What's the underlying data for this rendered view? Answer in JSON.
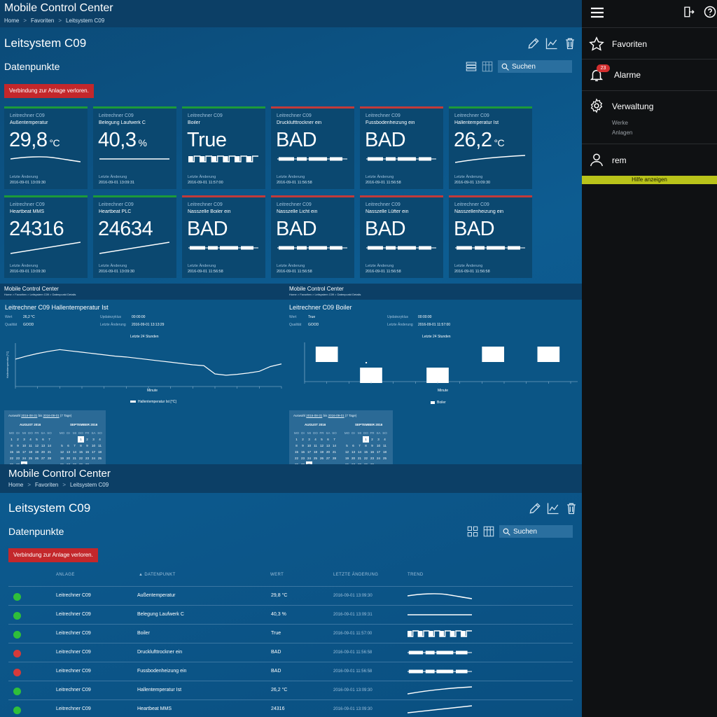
{
  "app": {
    "title": "Mobile Control Center"
  },
  "breadcrumb": [
    "Home",
    "Favoriten",
    "Leitsystem C09"
  ],
  "page": {
    "title": "Leitsystem C09",
    "subtitle": "Datenpunkte",
    "alert": "Verbindung zur Anlage verloren.",
    "search_placeholder": "Suchen"
  },
  "tiles": [
    {
      "source": "Leitrechner C09",
      "name": "Außentemperatur",
      "value": "29,8",
      "unit": "°C",
      "status": "ok",
      "trend": "line-down",
      "changed_label": "Letzte Änderung",
      "changed": "2016-09-01 13:09:30"
    },
    {
      "source": "Leitrechner C09",
      "name": "Belegung Laufwerk C",
      "value": "40,3",
      "unit": "%",
      "status": "ok",
      "trend": "flat",
      "changed_label": "Letzte Änderung",
      "changed": "2016-09-01 13:09:31"
    },
    {
      "source": "Leitrechner C09",
      "name": "Boiler",
      "value": "True",
      "unit": "",
      "status": "ok",
      "trend": "square",
      "changed_label": "Letzte Änderung",
      "changed": "2016-09-01 11:57:00"
    },
    {
      "source": "Leitrechner C09",
      "name": "Drucklufttrockner ein",
      "value": "BAD",
      "unit": "",
      "status": "bad",
      "trend": "bad",
      "changed_label": "Letzte Änderung",
      "changed": "2016-09-01 11:56:58"
    },
    {
      "source": "Leitrechner C09",
      "name": "Fussbodenheizung ein",
      "value": "BAD",
      "unit": "",
      "status": "bad",
      "trend": "bad",
      "changed_label": "Letzte Änderung",
      "changed": "2016-09-01 11:56:58"
    },
    {
      "source": "Leitrechner C09",
      "name": "Hallentemperatur Ist",
      "value": "26,2",
      "unit": "°C",
      "status": "ok",
      "trend": "line-up",
      "changed_label": "Letzte Änderung",
      "changed": "2016-09-01 13:09:30"
    },
    {
      "source": "Leitrechner C09",
      "name": "Heartbeat MMS",
      "value": "24316",
      "unit": "",
      "status": "ok",
      "trend": "rise",
      "changed_label": "Letzte Änderung",
      "changed": "2016-09-01 13:09:30"
    },
    {
      "source": "Leitrechner C09",
      "name": "Heartbeat PLC",
      "value": "24634",
      "unit": "",
      "status": "ok",
      "trend": "rise",
      "changed_label": "Letzte Änderung",
      "changed": "2016-09-01 13:09:30"
    },
    {
      "source": "Leitrechner C09",
      "name": "Nasszelle Boiler ein",
      "value": "BAD",
      "unit": "",
      "status": "bad",
      "trend": "bad",
      "changed_label": "Letzte Änderung",
      "changed": "2016-09-01 11:56:58"
    },
    {
      "source": "Leitrechner C09",
      "name": "Nasszelle Licht ein",
      "value": "BAD",
      "unit": "",
      "status": "bad",
      "trend": "bad",
      "changed_label": "Letzte Änderung",
      "changed": "2016-09-01 11:56:58"
    },
    {
      "source": "Leitrechner C09",
      "name": "Nasszelle Lüfter ein",
      "value": "BAD",
      "unit": "",
      "status": "bad",
      "trend": "bad",
      "changed_label": "Letzte Änderung",
      "changed": "2016-09-01 11:56:58"
    },
    {
      "source": "Leitrechner C09",
      "name": "Nasszellenheizung ein",
      "value": "BAD",
      "unit": "",
      "status": "bad",
      "trend": "bad",
      "changed_label": "Letzte Änderung",
      "changed": "2016-09-01 11:56:58"
    }
  ],
  "detail_left": {
    "app_title": "Mobile Control Center",
    "crumb": "Home  >  Favoriten  >  Leitsystem C09  >  Datenpunkt Details",
    "title": "Leitrechner C09 Hallentemperatur Ist",
    "fields": [
      {
        "label": "Wert",
        "value": "26,2 °C"
      },
      {
        "label": "Qualität",
        "value": "GOOD"
      },
      {
        "label": "Updatezyklus",
        "value": "00:00:00"
      },
      {
        "label": "Letzte Änderung",
        "value": "2016-09-01 13:13:29"
      }
    ],
    "chart_title": "Letzte 24 Stunden",
    "legend": "Hallentemperatur Ist [°C]",
    "xlabel": "Minute"
  },
  "detail_right": {
    "app_title": "Mobile Control Center",
    "crumb": "Home  >  Favoriten  >  Leitsystem C09  >  Datenpunkt Details",
    "title": "Leitrechner C09 Boiler",
    "fields": [
      {
        "label": "Wert",
        "value": "True"
      },
      {
        "label": "Qualität",
        "value": "GOOD"
      },
      {
        "label": "Updatezyklus",
        "value": "00:00:00"
      },
      {
        "label": "Letzte Änderung",
        "value": "2016-09-01 11:57:00"
      }
    ],
    "chart_title": "Letzte 24 Stunden",
    "legend": "Boiler",
    "xlabel": "Minute"
  },
  "chart_data": [
    {
      "type": "line",
      "title": "Letzte 24 Stunden",
      "ylabel": "Hallentemperatur [°C]",
      "xlabel": "Minute",
      "x": [
        0,
        1,
        2,
        3,
        4,
        5,
        6,
        7,
        8,
        9,
        10,
        11,
        12,
        13,
        14,
        15,
        16,
        17,
        18,
        19,
        20,
        21,
        22,
        23,
        24
      ],
      "series": [
        {
          "name": "Hallentemperatur Ist [°C]",
          "values": [
            26.3,
            27.0,
            27.6,
            28.1,
            28.5,
            28.2,
            27.9,
            27.6,
            27.3,
            27.0,
            26.8,
            26.5,
            26.2,
            25.9,
            25.6,
            25.3,
            25.0,
            24.8,
            22.9,
            22.6,
            22.8,
            23.1,
            23.5,
            24.6,
            25.2
          ]
        }
      ],
      "ylim": [
        20,
        30
      ]
    },
    {
      "type": "bar",
      "title": "Letzte 24 Stunden",
      "xlabel": "Minute",
      "x": [
        0,
        1,
        2,
        3,
        4,
        5,
        6,
        7,
        8,
        9,
        10,
        11,
        12,
        13,
        14,
        15,
        16,
        17,
        18,
        19,
        20,
        21,
        22,
        23,
        24
      ],
      "series": [
        {
          "name": "Boiler",
          "values": [
            0,
            1,
            1,
            0,
            0,
            -1,
            -1,
            0,
            0,
            0,
            0,
            -1,
            -1,
            0,
            0,
            0,
            1,
            1,
            0,
            0,
            0,
            1,
            1,
            0,
            0
          ]
        }
      ],
      "ylim": [
        -1,
        1
      ]
    }
  ],
  "calendar_left": {
    "range_label": "Auswahl",
    "from": "2016-08-31",
    "to_label": "bis",
    "to": "2016-09-01",
    "days": "(7 Tage)",
    "months": [
      {
        "name": "AUGUST 2016",
        "weekdays": [
          "MO",
          "DI",
          "MI",
          "DO",
          "FR",
          "SA",
          "SO"
        ],
        "days": [
          "1",
          "2",
          "3",
          "4",
          "5",
          "6",
          "7",
          "8",
          "9",
          "10",
          "11",
          "12",
          "13",
          "14",
          "15",
          "16",
          "17",
          "18",
          "19",
          "20",
          "21",
          "22",
          "23",
          "24",
          "25",
          "26",
          "27",
          "28",
          "29",
          "30",
          "31"
        ],
        "first_offset": 0,
        "current": "31"
      },
      {
        "name": "SEPTEMBER 2016",
        "weekdays": [
          "MO",
          "DI",
          "MI",
          "DO",
          "FR",
          "SA",
          "SO"
        ],
        "days": [
          "1",
          "2",
          "3",
          "4",
          "5",
          "6",
          "7",
          "8",
          "9",
          "10",
          "11",
          "12",
          "13",
          "14",
          "15",
          "16",
          "17",
          "18",
          "19",
          "20",
          "21",
          "22",
          "23",
          "24",
          "25",
          "26",
          "27",
          "28",
          "29",
          "30"
        ],
        "first_offset": 3,
        "current": "1"
      }
    ]
  },
  "calendar_right": {
    "range_label": "Auswahl",
    "from": "2016-08-31",
    "to_label": "bis",
    "to": "2016-09-01",
    "days": "(7 Tage)",
    "months": [
      {
        "name": "AUGUST 2016",
        "weekdays": [
          "MO",
          "DI",
          "MI",
          "DO",
          "FR",
          "SA",
          "SO"
        ],
        "days": [
          "1",
          "2",
          "3",
          "4",
          "5",
          "6",
          "7",
          "8",
          "9",
          "10",
          "11",
          "12",
          "13",
          "14",
          "15",
          "16",
          "17",
          "18",
          "19",
          "20",
          "21",
          "22",
          "23",
          "24",
          "25",
          "26",
          "27",
          "28",
          "29",
          "30",
          "31"
        ],
        "first_offset": 0,
        "current": "31"
      },
      {
        "name": "SEPTEMBER 2016",
        "weekdays": [
          "MO",
          "DI",
          "MI",
          "DO",
          "FR",
          "SA",
          "SO"
        ],
        "days": [
          "1",
          "2",
          "3",
          "4",
          "5",
          "6",
          "7",
          "8",
          "9",
          "10",
          "11",
          "12",
          "13",
          "14",
          "15",
          "16",
          "17",
          "18",
          "19",
          "20",
          "21",
          "22",
          "23",
          "24",
          "25",
          "26",
          "27",
          "28",
          "29",
          "30"
        ],
        "first_offset": 3,
        "current": "1"
      }
    ]
  },
  "table": {
    "columns": [
      "ANLAGE",
      "DATENPUNKT",
      "WERT",
      "LETZTE ÄNDERUNG",
      "TREND"
    ],
    "rows": [
      {
        "status": "ok",
        "anlage": "Leitrechner C09",
        "datenpunkt": "Außentemperatur",
        "wert": "29,8 °C",
        "changed": "2016-09-01 13:09:30",
        "trend": "line-down"
      },
      {
        "status": "ok",
        "anlage": "Leitrechner C09",
        "datenpunkt": "Belegung Laufwerk C",
        "wert": "40,3 %",
        "changed": "2016-09-01 13:09:31",
        "trend": "flat"
      },
      {
        "status": "ok",
        "anlage": "Leitrechner C09",
        "datenpunkt": "Boiler",
        "wert": "True",
        "changed": "2016-09-01 11:57:00",
        "trend": "square"
      },
      {
        "status": "bad",
        "anlage": "Leitrechner C09",
        "datenpunkt": "Drucklufttrockner ein",
        "wert": "BAD",
        "changed": "2016-09-01 11:56:58",
        "trend": "bad"
      },
      {
        "status": "bad",
        "anlage": "Leitrechner C09",
        "datenpunkt": "Fussbodenheizung ein",
        "wert": "BAD",
        "changed": "2016-09-01 11:56:58",
        "trend": "bad"
      },
      {
        "status": "ok",
        "anlage": "Leitrechner C09",
        "datenpunkt": "Hallentemperatur Ist",
        "wert": "26,2 °C",
        "changed": "2016-09-01 13:09:30",
        "trend": "line-up"
      },
      {
        "status": "ok",
        "anlage": "Leitrechner C09",
        "datenpunkt": "Heartbeat MMS",
        "wert": "24316",
        "changed": "2016-09-01 13:09:30",
        "trend": "rise"
      }
    ]
  },
  "sidebar": {
    "items": [
      {
        "label": "Favoriten",
        "icon": "star-icon"
      },
      {
        "label": "Alarme",
        "icon": "bell-icon",
        "badge": "23"
      },
      {
        "label": "Verwaltung",
        "icon": "gear-icon",
        "subitems": [
          "Werke",
          "Anlagen"
        ]
      },
      {
        "label": "rem",
        "icon": "user-icon"
      }
    ],
    "help": "Hilfe anzeigen"
  },
  "colors": {
    "ok": "#1c9a3a",
    "bad": "#c23a3a",
    "help": "#b9c31a",
    "alert": "#c3272b"
  }
}
